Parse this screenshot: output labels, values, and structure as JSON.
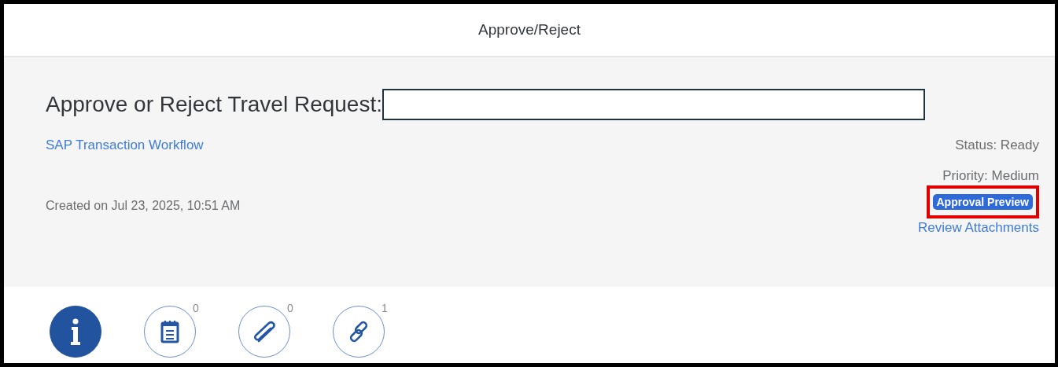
{
  "window": {
    "title": "Approve/Reject"
  },
  "header": {
    "title": "Approve or Reject Travel Request:",
    "workflow_link": "SAP Transaction Workflow",
    "created": "Created on Jul 23, 2025, 10:51 AM",
    "status": "Status: Ready",
    "priority": "Priority: Medium",
    "preview_button": {
      "label": "Approval Preview",
      "highlighted": true
    },
    "attachments_link": "Review Attachments"
  },
  "tabs": [
    {
      "kind": "info",
      "selected": true
    },
    {
      "kind": "notes",
      "selected": false,
      "count": "0"
    },
    {
      "kind": "attachments",
      "selected": false,
      "count": "0"
    },
    {
      "kind": "links",
      "selected": false,
      "count": "1"
    }
  ]
}
